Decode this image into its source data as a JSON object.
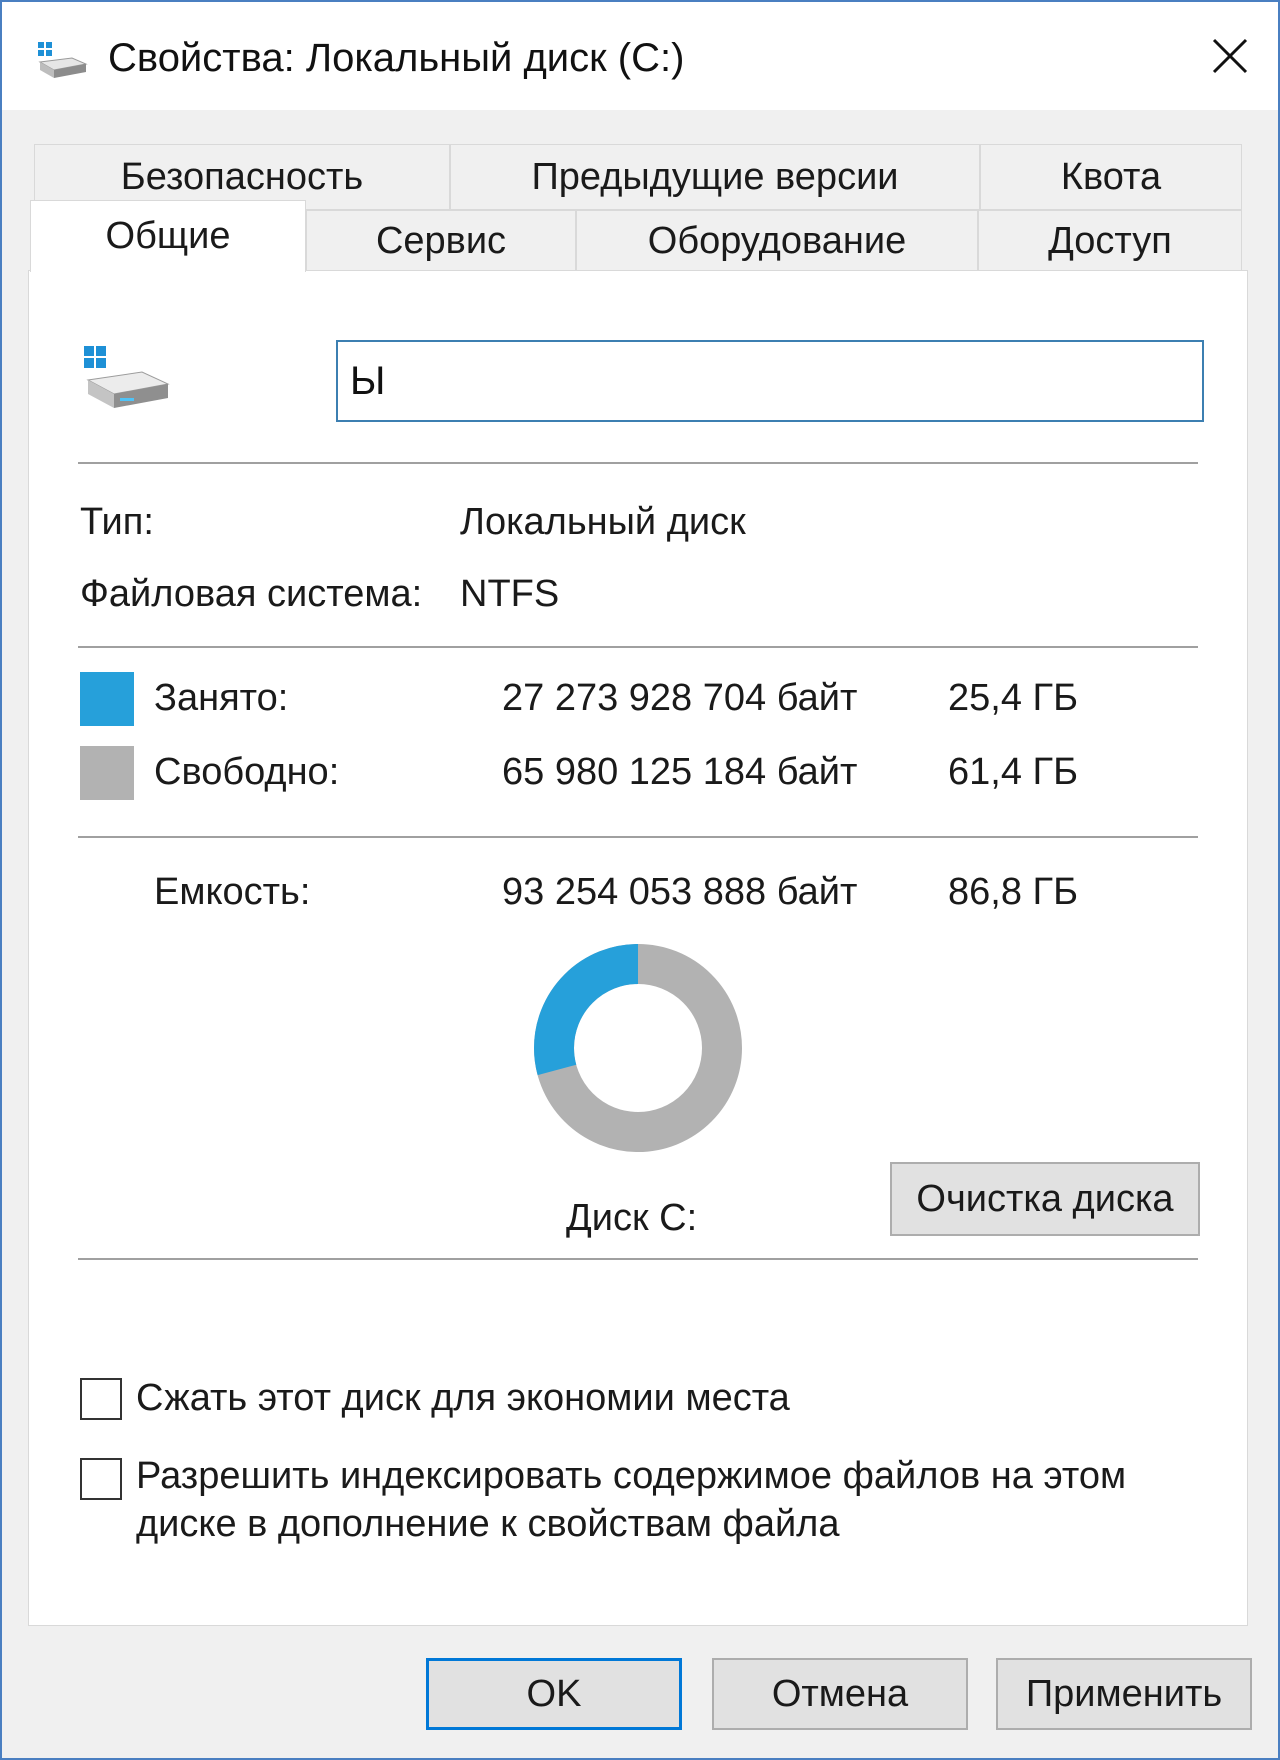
{
  "window": {
    "title": "Свойства: Локальный диск (C:)",
    "icons": {
      "title": "drive-icon",
      "close": "close-icon"
    }
  },
  "tabs": {
    "row1": [
      "Безопасность",
      "Предыдущие версии",
      "Квота"
    ],
    "row2": [
      "Общие",
      "Сервис",
      "Оборудование",
      "Доступ"
    ],
    "active": "Общие"
  },
  "general": {
    "volume_name": "Ы",
    "type_label": "Тип:",
    "type_value": "Локальный диск",
    "fs_label": "Файловая система:",
    "fs_value": "NTFS",
    "used_label": "Занято:",
    "used_bytes": "27 273 928 704 байт",
    "used_size": "25,4 ГБ",
    "free_label": "Свободно:",
    "free_bytes": "65 980 125 184 байт",
    "free_size": "61,4 ГБ",
    "capacity_label": "Емкость:",
    "capacity_bytes": "93 254 053 888 байт",
    "capacity_size": "86,8 ГБ",
    "drive_label": "Диск C:",
    "cleanup_button": "Очистка диска",
    "compress_label": "Сжать этот диск для экономии места",
    "compress_checked": false,
    "index_label": "Разрешить индексировать содержимое файлов на этом диске в дополнение к свойствам файла",
    "index_checked": false
  },
  "usage": {
    "used_fraction": 0.292,
    "colors": {
      "used": "#26a0da",
      "free": "#b2b2b2"
    }
  },
  "buttons": {
    "ok": "OK",
    "cancel": "Отмена",
    "apply": "Применить"
  }
}
